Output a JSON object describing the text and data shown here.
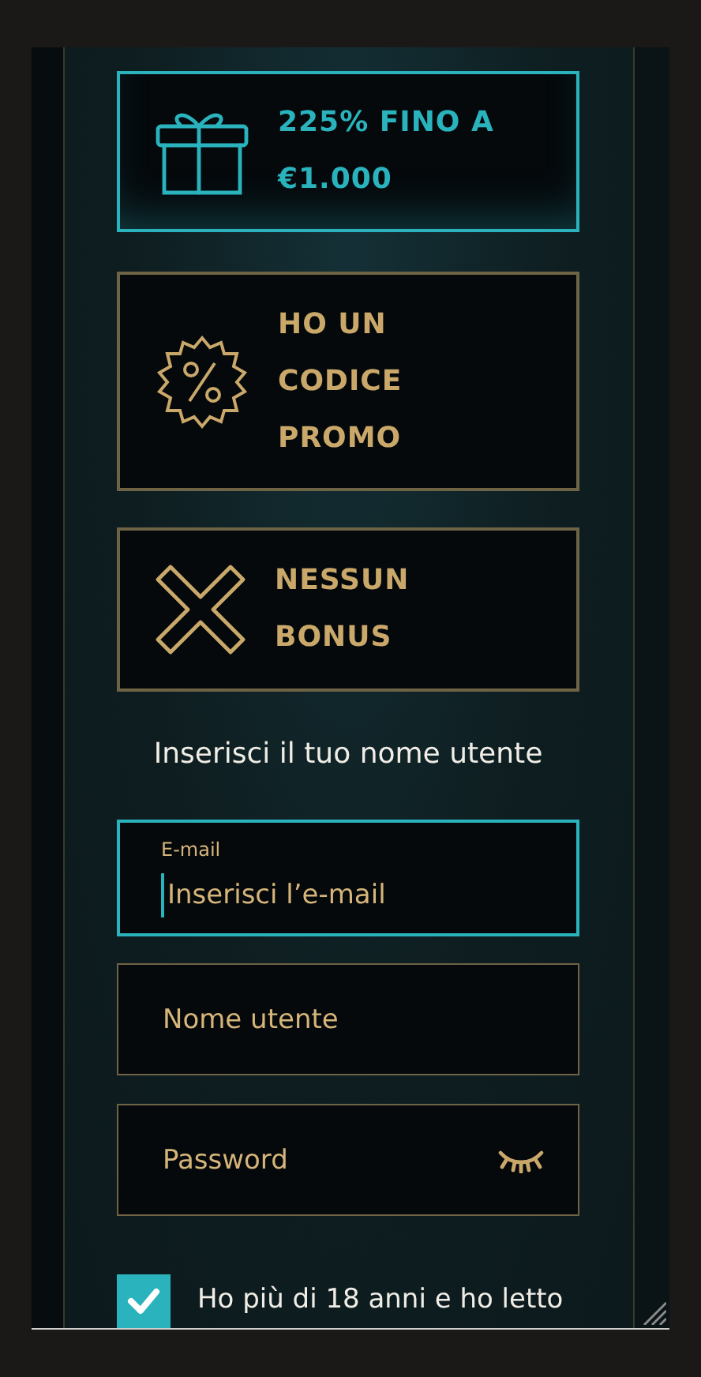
{
  "bonus_options": [
    {
      "kind": "gift",
      "lines": [
        "225% FINO A",
        "€1.000"
      ],
      "selected": true
    },
    {
      "kind": "percent",
      "lines": [
        "HO UN",
        "CODICE",
        "PROMO"
      ],
      "selected": false
    },
    {
      "kind": "cross",
      "lines": [
        "NESSUN",
        "BONUS"
      ],
      "selected": false
    }
  ],
  "prompt": "Inserisci il tuo nome utente",
  "fields": [
    {
      "kind": "email",
      "label": "E-mail",
      "placeholder": "Inserisci l’e-mail",
      "focused": true
    },
    {
      "kind": "text",
      "placeholder": "Nome utente",
      "focused": false
    },
    {
      "kind": "password",
      "placeholder": "Password",
      "focused": false
    }
  ],
  "age_consent": {
    "checked": true,
    "label": "Ho più di 18 anni e ho letto"
  }
}
